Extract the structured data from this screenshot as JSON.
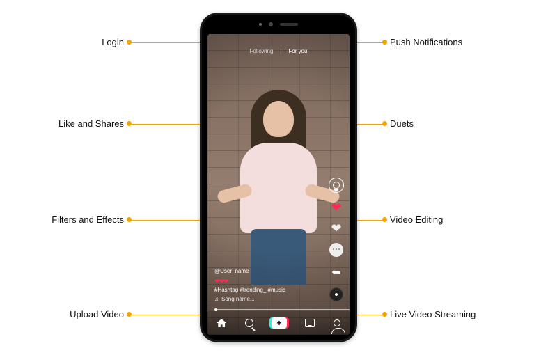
{
  "labels": {
    "left": [
      {
        "key": "login",
        "text": "Login"
      },
      {
        "key": "like_shares",
        "text": "Like and Shares"
      },
      {
        "key": "filters_effects",
        "text": "Filters and Effects"
      },
      {
        "key": "upload_video",
        "text": "Upload Video"
      }
    ],
    "right": [
      {
        "key": "push_notifications",
        "text": "Push Notifications"
      },
      {
        "key": "duets",
        "text": "Duets"
      },
      {
        "key": "video_editing",
        "text": "Video Editing"
      },
      {
        "key": "live_video_streaming",
        "text": "Live Video Streaming"
      }
    ]
  },
  "tabs": {
    "following": "Following",
    "foryou": "For you"
  },
  "info": {
    "username": "@User_name",
    "hashtags": "#Hashtag  #trending_ #music",
    "song": "Song name..."
  },
  "nav": {
    "plus_glyph": "+"
  },
  "colors": {
    "callout": "#f0a500",
    "accent_red": "#fe2c55",
    "accent_cyan": "#25f4ee"
  }
}
